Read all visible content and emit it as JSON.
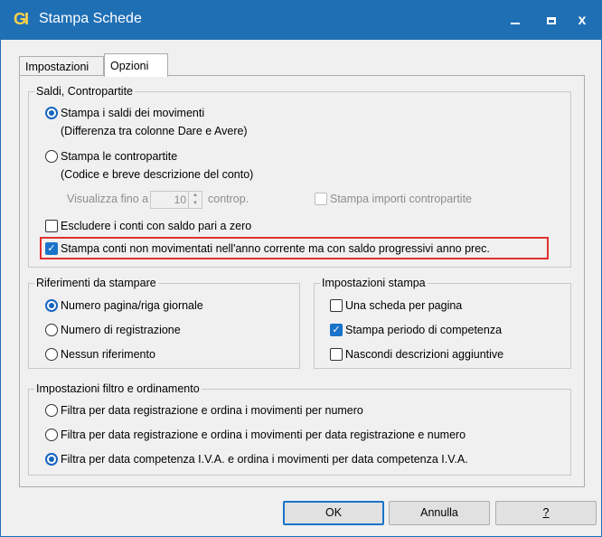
{
  "window": {
    "title": "Stampa Schede",
    "logo": "GI",
    "close_glyph": "x"
  },
  "tabs": [
    {
      "label": "Impostazioni",
      "active": false
    },
    {
      "label": "Opzioni",
      "active": true
    }
  ],
  "saldi": {
    "legend": "Saldi, Contropartite",
    "opt_saldi": {
      "label": "Stampa i saldi dei movimenti",
      "sub": "(Differenza tra colonne Dare e Avere)",
      "checked": true
    },
    "opt_contro": {
      "label": "Stampa le contropartite",
      "sub": "(Codice e breve descrizione del conto)",
      "checked": false
    },
    "visualizza_label": "Visualizza fino a",
    "visualizza_value": "10",
    "visualizza_unit": "controp.",
    "stampa_importi": {
      "label": "Stampa importi contropartite",
      "checked": false,
      "disabled": true
    },
    "escludere": {
      "label": "Escludere i conti con saldo pari a zero",
      "checked": false
    },
    "stampa_conti": {
      "label": "Stampa conti non movimentati nell'anno corrente ma con saldo progressivi anno prec.",
      "checked": true
    }
  },
  "riferimenti": {
    "legend": "Riferimenti da stampare",
    "options": [
      {
        "label": "Numero pagina/riga giornale",
        "checked": true
      },
      {
        "label": "Numero di registrazione",
        "checked": false
      },
      {
        "label": "Nessun riferimento",
        "checked": false
      }
    ]
  },
  "impostazioni_stampa": {
    "legend": "Impostazioni stampa",
    "options": [
      {
        "label": "Una scheda per pagina",
        "checked": false
      },
      {
        "label": "Stampa periodo di competenza",
        "checked": true
      },
      {
        "label": "Nascondi descrizioni aggiuntive",
        "checked": false
      }
    ]
  },
  "filtro": {
    "legend": "Impostazioni filtro e ordinamento",
    "options": [
      {
        "label": "Filtra per data registrazione e ordina i movimenti per numero",
        "checked": false
      },
      {
        "label": "Filtra per data registrazione e ordina i movimenti per data registrazione e numero",
        "checked": false
      },
      {
        "label": "Filtra per data competenza I.V.A. e ordina i movimenti per data competenza I.V.A.",
        "checked": true
      }
    ]
  },
  "buttons": {
    "ok": "OK",
    "annulla": "Annulla",
    "help": "?"
  },
  "colors": {
    "titlebar": "#1f6fb5",
    "accent": "#1a73c9",
    "highlight": "#e03030"
  }
}
